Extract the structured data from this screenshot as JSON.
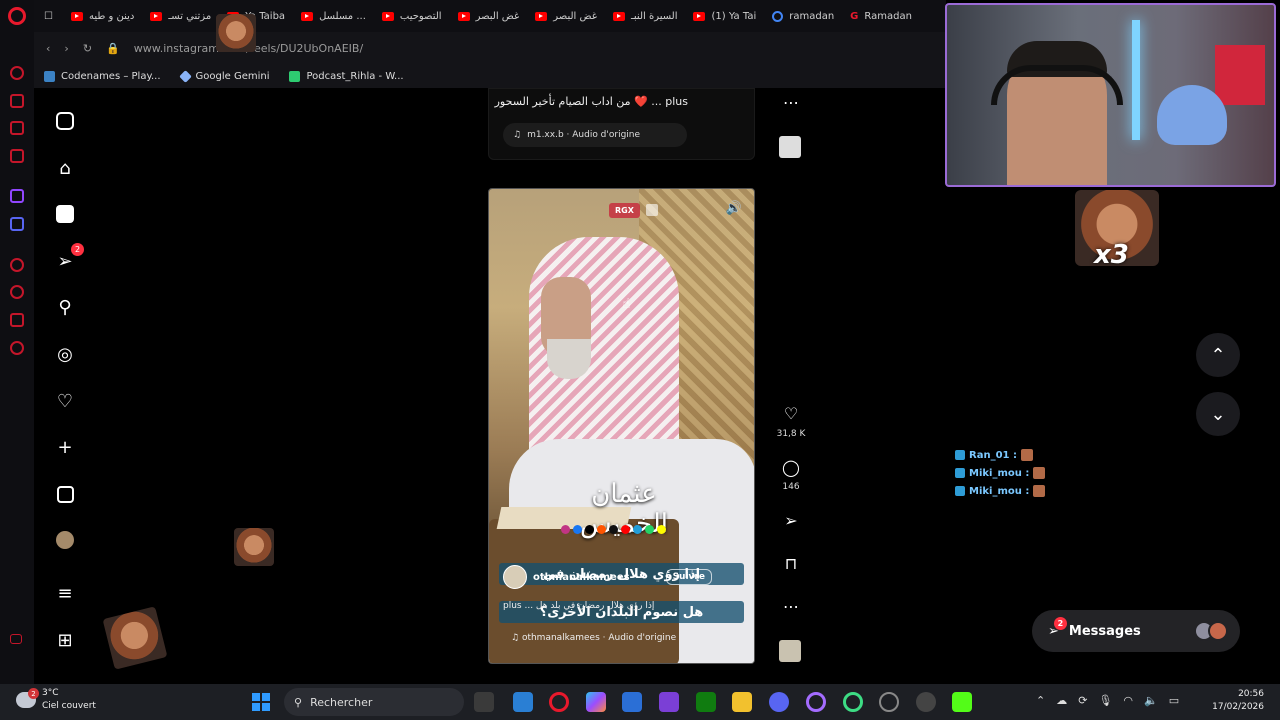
{
  "browser": {
    "tabs": [
      {
        "label": "دينن و طيه",
        "icon": "youtube-icon"
      },
      {
        "label": "مزتني تسـ",
        "icon": "youtube-icon"
      },
      {
        "label": "Ya Taiba",
        "icon": "youtube-icon"
      },
      {
        "label": "مسلسل ...",
        "icon": "youtube-icon"
      },
      {
        "label": "التصوحيب",
        "icon": "youtube-icon"
      },
      {
        "label": "غض البصر",
        "icon": "youtube-icon"
      },
      {
        "label": "غض البصر",
        "icon": "youtube-icon"
      },
      {
        "label": "السيرة النبـ",
        "icon": "youtube-icon"
      },
      {
        "label": "(1) Ya Tai",
        "icon": "youtube-icon"
      },
      {
        "label": "ramadan",
        "icon": "google-icon"
      },
      {
        "label": "Ramadan",
        "icon": "gx-icon"
      }
    ],
    "url": "www.instagram.com/reels/DU2UbOnAEIB/",
    "bookmarks": [
      {
        "label": "Codenames – Play...",
        "color": "#3b82c4"
      },
      {
        "label": "Google Gemini",
        "color": "#8ab4f8"
      },
      {
        "label": "Podcast_Rihla - W...",
        "color": "#2ecc71"
      }
    ]
  },
  "instagram": {
    "notification_count": "2",
    "prev_post": {
      "caption": "من اداب الصيام تأخير السحور ❤️ ... plus",
      "audio": "m1.xx.b · Audio d'origine"
    },
    "reel": {
      "rgx_label": "RGX",
      "calligraphy": "عثمان الخميس",
      "subtitle_line1": "إذا رؤي هلال رمضان في",
      "subtitle_line2": "هل نصوم البلدان الأخرى؟",
      "username": "othmanalkamees",
      "follow_label": "Suivre",
      "caption": "plus ... إذا رؤي هلال رمضان في بلد هل",
      "audio": "othmanalkamees · Audio d'origine"
    },
    "actions": {
      "likes": "31,8 K",
      "comments": "146"
    },
    "messages_label": "Messages",
    "messages_badge": "2"
  },
  "stream_overlay": {
    "multiplier": "x3",
    "chat": [
      {
        "user": "Ran_01 :"
      },
      {
        "user": "Miki_mou :"
      },
      {
        "user": "Miki_mou :"
      }
    ]
  },
  "taskbar": {
    "weather_temp": "3°C",
    "weather_desc": "Ciel couvert",
    "weather_badge": "2",
    "search_placeholder": "Rechercher",
    "time": "20:56",
    "date": "17/02/2026"
  },
  "colors": {
    "opera_red": "#e8192c",
    "instagram_badge": "#ff3040",
    "webcam_border": "#9b6bd6",
    "chat_name": "#7bc8ff"
  }
}
